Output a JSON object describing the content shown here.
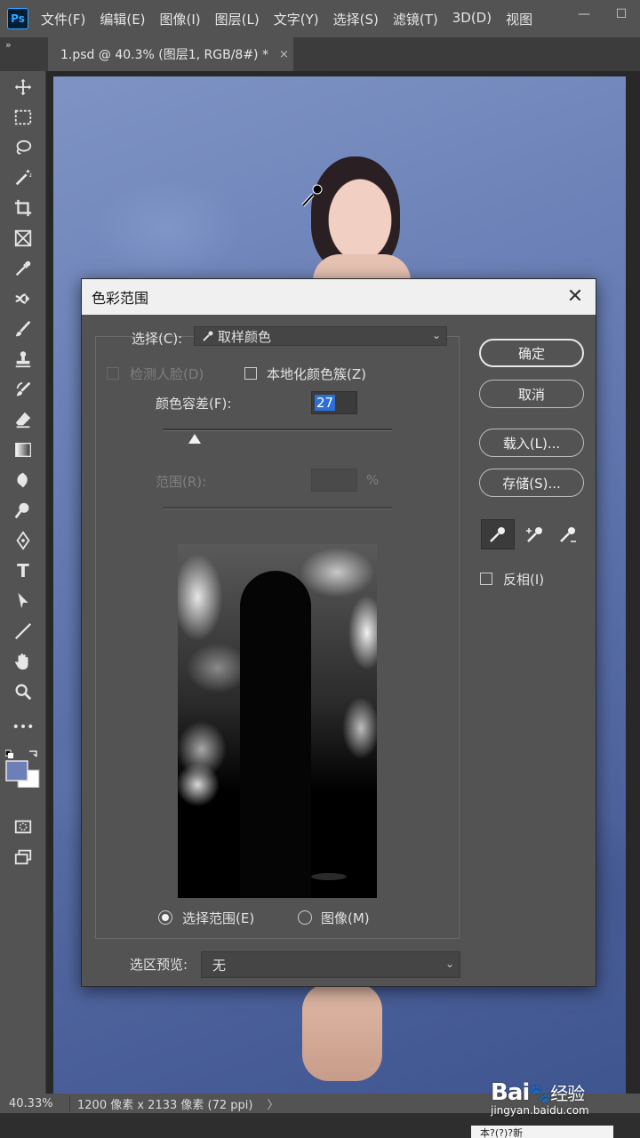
{
  "app": {
    "logo": "Ps",
    "menus": [
      "文件(F)",
      "编辑(E)",
      "图像(I)",
      "图层(L)",
      "文字(Y)",
      "选择(S)",
      "滤镜(T)",
      "3D(D)",
      "视图"
    ],
    "window_controls": {
      "minimize": "—",
      "maximize": "☐"
    }
  },
  "tabs": {
    "expand": "»",
    "document": "1.psd @ 40.3% (图层1, RGB/8#) *",
    "close": "×"
  },
  "tools": [
    "move-icon",
    "marquee-icon",
    "lasso-icon",
    "magic-wand-icon",
    "crop-icon",
    "frame-icon",
    "eyedropper-icon",
    "healing-icon",
    "brush-icon",
    "stamp-icon",
    "history-brush-icon",
    "eraser-icon",
    "gradient-icon",
    "blur-icon",
    "dodge-icon",
    "pen-icon",
    "type-icon",
    "path-select-icon",
    "line-icon",
    "hand-icon",
    "zoom-icon",
    "more-icon"
  ],
  "tool_labels": {
    "type": "T",
    "more": "•••"
  },
  "colors": {
    "foreground": "#6c7fb6",
    "background": "#ffffff"
  },
  "status": {
    "zoom": "40.33%",
    "doc_size": "1200 像素 x 2133 像素 (72 ppi)",
    "arrow": "〉"
  },
  "watermark": {
    "logo": "Bai",
    "logo_paw": "🐾",
    "logo_suffix": "经验",
    "url": "jingyan.baidu.com"
  },
  "bottom_notice": "本?(?)?新",
  "dialog": {
    "title": "色彩范围",
    "close": "✕",
    "select_label": "选择(C):",
    "select_value": "取样颜色",
    "detect_faces_label": "检测人脸(D)",
    "localized_label": "本地化颜色簇(Z)",
    "fuzziness_label": "颜色容差(F):",
    "fuzziness_value": "27",
    "fuzziness": 0.14,
    "range_label": "范围(R):",
    "range_unit": "%",
    "radio_selection": "选择范围(E)",
    "radio_image": "图像(M)",
    "preview_label": "选区预览:",
    "preview_value": "无",
    "buttons": {
      "ok": "确定",
      "cancel": "取消",
      "load": "载入(L)...",
      "save": "存储(S)..."
    },
    "invert_label": "反相(I)",
    "pickers": [
      "eyedropper-icon",
      "add-to-sample-icon",
      "subtract-from-sample-icon"
    ]
  }
}
